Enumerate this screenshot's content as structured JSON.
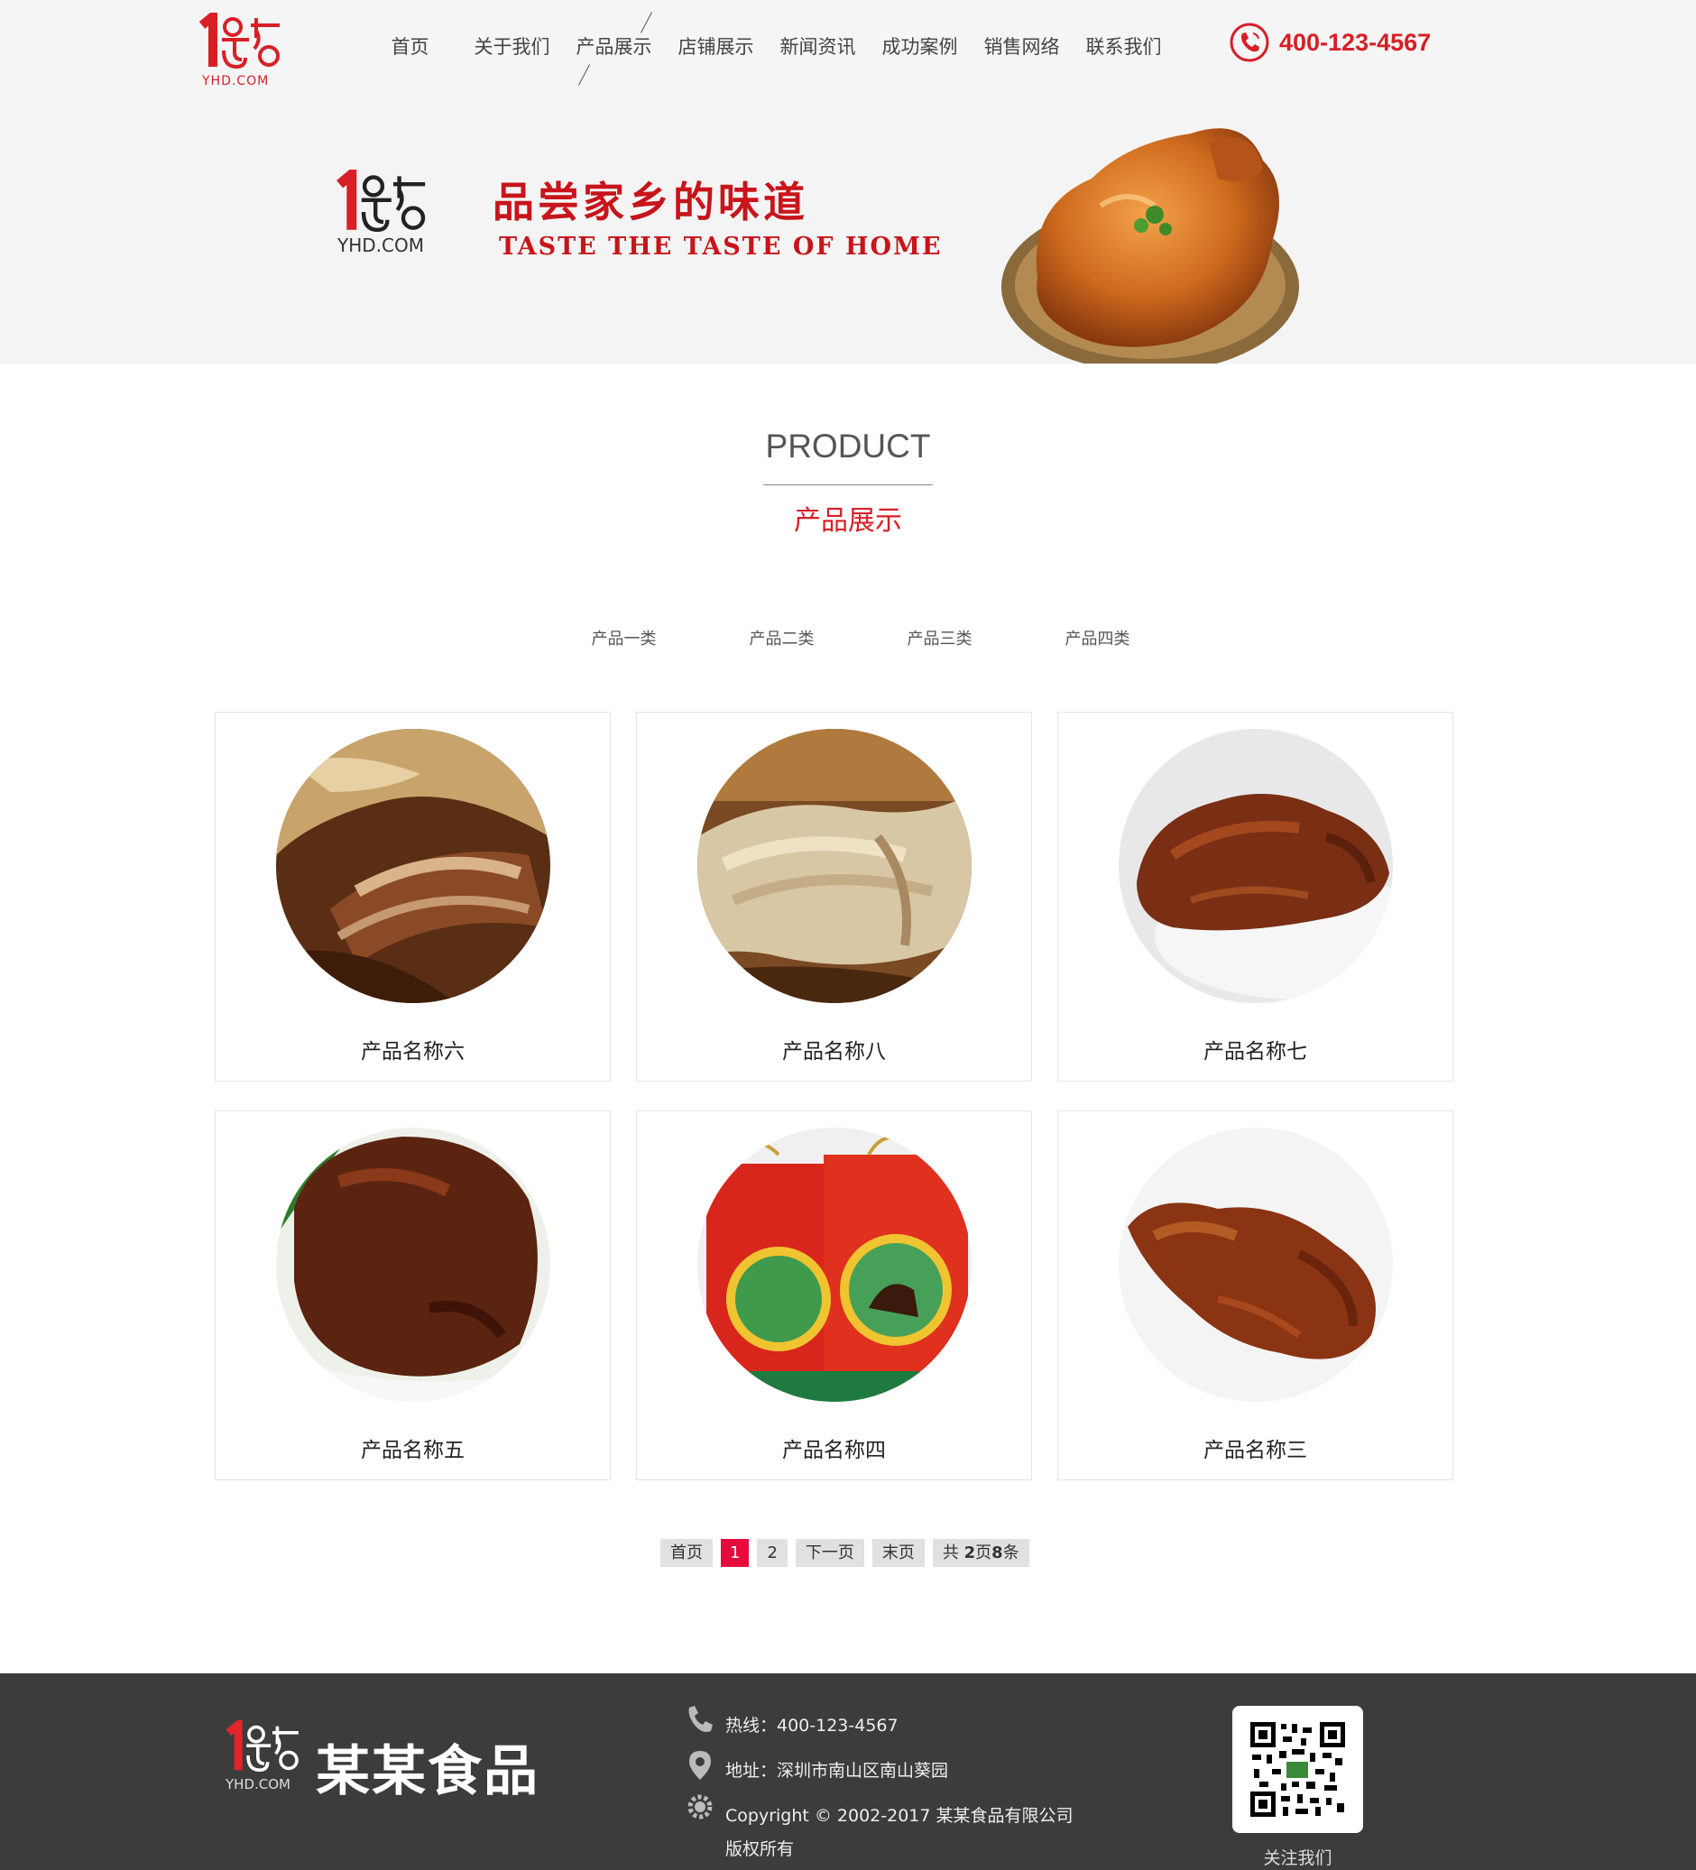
{
  "header": {
    "logo_sub": "YHD.COM",
    "nav": [
      "首页",
      "关于我们",
      "产品展示",
      "店铺展示",
      "新闻资讯",
      "成功案例",
      "销售网络",
      "联系我们"
    ],
    "active_nav": 2,
    "phone": "400-123-4567"
  },
  "banner": {
    "logo_sub": "YHD.COM",
    "title": "品尝家乡的味道",
    "subtitle": "TASTE THE TASTE OF HOME"
  },
  "section": {
    "title_en": "PRODUCT",
    "title_cn": "产品展示"
  },
  "tabs": [
    "产品一类",
    "产品二类",
    "产品三类",
    "产品四类"
  ],
  "products": [
    {
      "name": "产品名称六",
      "image": "braised-meat"
    },
    {
      "name": "产品名称八",
      "image": "pulled-chicken"
    },
    {
      "name": "产品名称七",
      "image": "roast-chicken-plate"
    },
    {
      "name": "产品名称五",
      "image": "braised-pork-knuckle"
    },
    {
      "name": "产品名称四",
      "image": "gift-boxes"
    },
    {
      "name": "产品名称三",
      "image": "roast-chicken"
    }
  ],
  "pager": {
    "first": "首页",
    "pages": [
      "1",
      "2"
    ],
    "current": "1",
    "next": "下一页",
    "last": "末页",
    "summary_prefix": "共 ",
    "total_pages": "2",
    "summary_mid": "页",
    "total_items": "8",
    "summary_suffix": "条"
  },
  "footer": {
    "logo_sub": "YHD.COM",
    "company": "某某食品",
    "hotline": "热线：400-123-4567",
    "address": "地址：深圳市南山区南山葵园",
    "copyright": "Copyright © 2002-2017 某某食品有限公司 版权所有",
    "qr_label": "关注我们"
  },
  "colors": {
    "brand_red": "#d81f26",
    "pager_active": "#e60b3c",
    "footer_bg": "#3c3c3c"
  }
}
